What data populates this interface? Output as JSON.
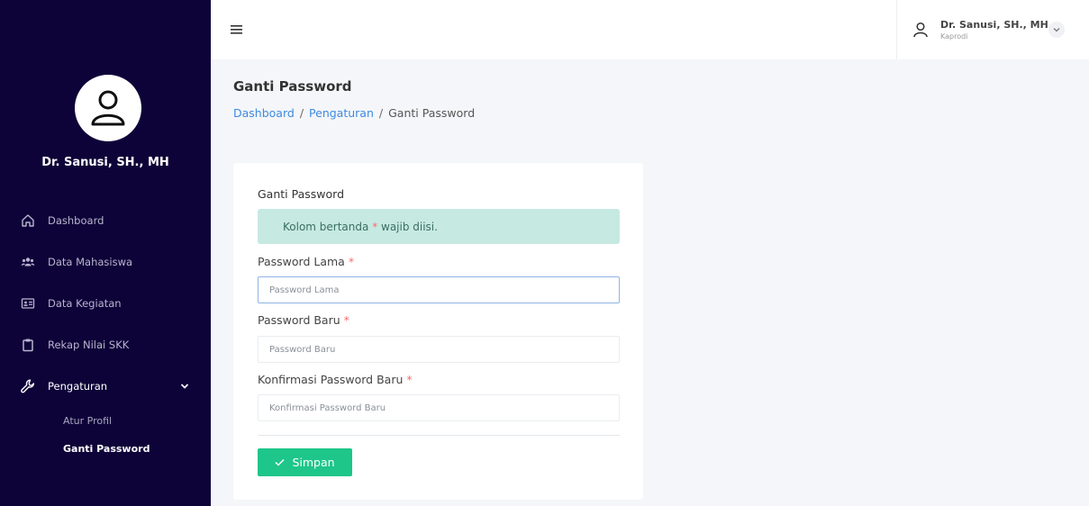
{
  "sidebar": {
    "user_name": "Dr. Sanusi, SH., MH",
    "items": [
      {
        "label": "Dashboard",
        "icon": "home-icon"
      },
      {
        "label": "Data Mahasiswa",
        "icon": "users-icon"
      },
      {
        "label": "Data Kegiatan",
        "icon": "id-card-icon"
      },
      {
        "label": "Rekap Nilai SKK",
        "icon": "clipboard-icon"
      },
      {
        "label": "Pengaturan",
        "icon": "wrench-icon"
      }
    ],
    "sub_items": [
      {
        "label": "Atur Profil"
      },
      {
        "label": "Ganti Password"
      }
    ]
  },
  "topbar": {
    "user_name": "Dr. Sanusi, SH., MH",
    "user_role": "Kaprodi"
  },
  "page": {
    "title": "Ganti Password",
    "breadcrumb": [
      "Dashboard",
      "Pengaturan",
      "Ganti Password"
    ]
  },
  "form": {
    "title": "Ganti Password",
    "alert_prefix": "Kolom bertanda ",
    "alert_star": "*",
    "alert_suffix": " wajib diisi.",
    "required_mark": "*",
    "fields": [
      {
        "label": "Password Lama",
        "placeholder": "Password Lama",
        "value": ""
      },
      {
        "label": "Password Baru",
        "placeholder": "Password Baru",
        "value": ""
      },
      {
        "label": "Konfirmasi Password Baru",
        "placeholder": "Konfirmasi Password Baru",
        "value": ""
      }
    ],
    "save_label": "Simpan"
  },
  "colors": {
    "sidebar_bg": "#0e0338",
    "accent_green": "#1ec689",
    "alert_bg": "#c6e9e2",
    "link_blue": "#3f8ae0",
    "required_red": "#ff6b6b"
  }
}
